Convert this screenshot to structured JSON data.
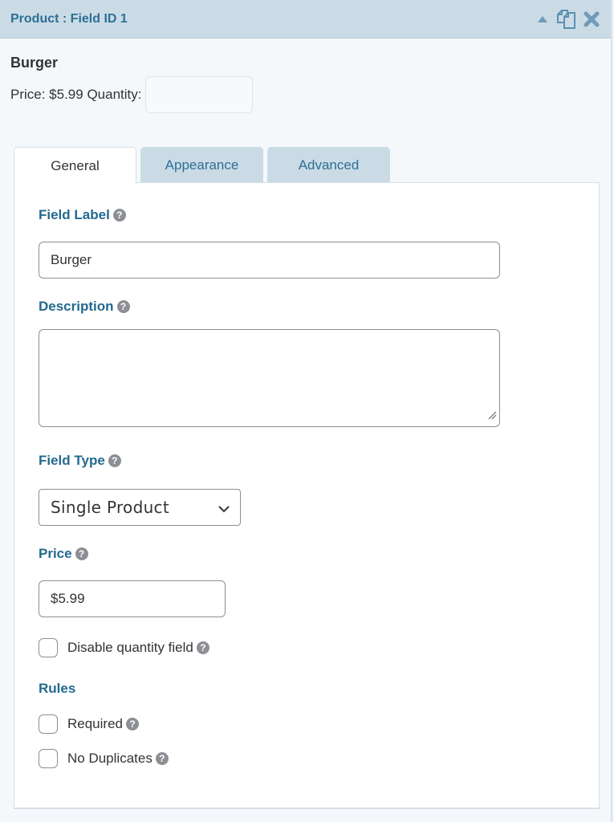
{
  "header": {
    "title": "Product : Field ID 1",
    "icons": [
      "collapse-arrow-icon",
      "duplicate-icon",
      "delete-icon"
    ]
  },
  "preview": {
    "name": "Burger",
    "price_text": "Price: $5.99 Quantity:",
    "quantity_value": ""
  },
  "tabs": [
    {
      "label": "General",
      "active": true
    },
    {
      "label": "Appearance",
      "active": false
    },
    {
      "label": "Advanced",
      "active": false
    }
  ],
  "general": {
    "field_label": {
      "label": "Field Label",
      "value": "Burger"
    },
    "description": {
      "label": "Description",
      "value": ""
    },
    "field_type": {
      "label": "Field Type",
      "selected": "Single Product"
    },
    "price": {
      "label": "Price",
      "value": "$5.99"
    },
    "disable_quantity": {
      "label": "Disable quantity field",
      "checked": false
    },
    "rules": {
      "heading": "Rules",
      "required": {
        "label": "Required",
        "checked": false
      },
      "no_duplicates": {
        "label": "No Duplicates",
        "checked": false
      }
    }
  },
  "colors": {
    "header_bg": "#cbdbe5",
    "accent": "#2d6f97",
    "label": "#23698f",
    "help_icon": "#8c8f94"
  },
  "help_glyph": "?"
}
